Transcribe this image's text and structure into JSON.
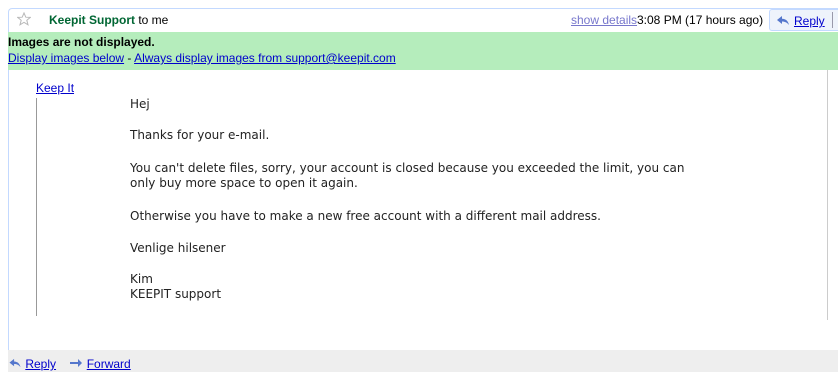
{
  "header": {
    "sender": "Keepit Support",
    "recipient": "to me",
    "show_details": "show details",
    "time": "3:08 PM (17 hours ago)",
    "reply": "Reply",
    "more_icon": "chevron-down-icon"
  },
  "banner": {
    "title": "Images are not displayed.",
    "display_below": "Display images below",
    "separator": " - ",
    "always_display": "Always display images from support@keepit.com",
    "background": "#b5edbc"
  },
  "message": {
    "image_link": "Keep It",
    "greeting": "Hej",
    "thanks": "Thanks for your e-mail.",
    "paragraph1_line1": "You can't delete files, sorry, your account is closed because you exceeded the limit, you can",
    "paragraph1_line2": "only buy more space to open it again.",
    "paragraph2": "Otherwise you have to make a new free account with a different mail address.",
    "closing": "Venlige hilsener",
    "signature_name": "Kim",
    "signature_team": "KEEPIT support"
  },
  "footer": {
    "reply": "Reply",
    "forward": "Forward"
  },
  "colors": {
    "sender": "#006633",
    "link": "#0000cc",
    "header_border": "#c3d9ff"
  }
}
